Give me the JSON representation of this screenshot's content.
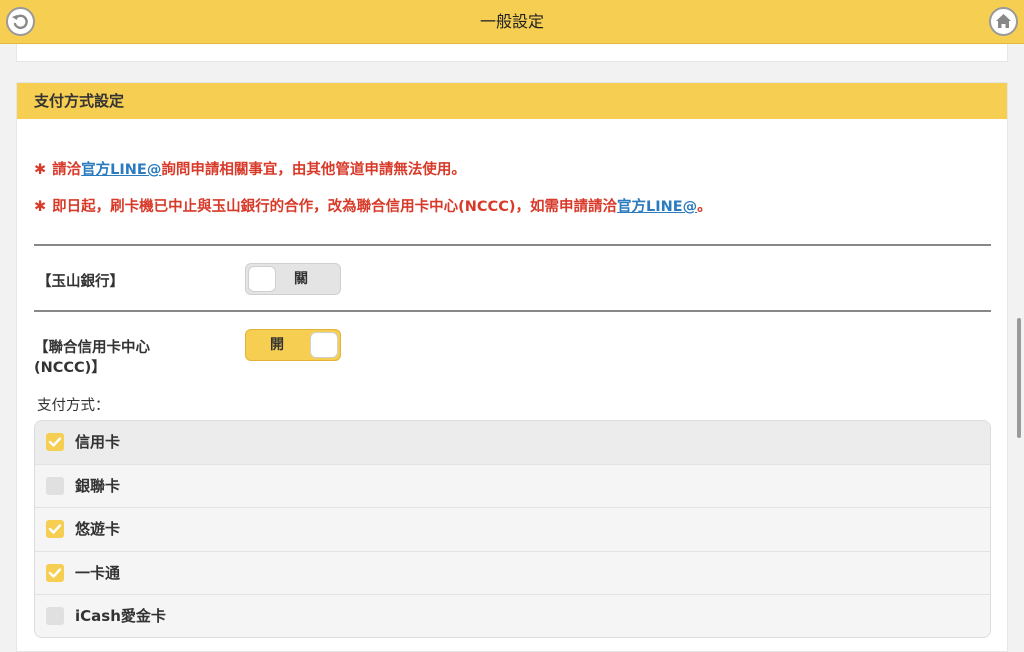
{
  "header": {
    "title": "一般設定"
  },
  "section": {
    "title": "支付方式設定",
    "notice1": {
      "star": "✱",
      "before": "請洽",
      "link": "官方LINE@",
      "after": "詢問申請相關事宜，由其他管道申請無法使用。"
    },
    "notice2": {
      "star": "✱",
      "before": "即日起，刷卡機已中止與玉山銀行的合作，改為聯合信用卡中心(NCCC)，如需申請請洽",
      "link": "官方LINE@",
      "after": "。"
    }
  },
  "banks": [
    {
      "label": "【玉山銀行】",
      "toggle_text": "關",
      "on": false
    },
    {
      "label_line1": "【聯合信用卡中心",
      "label_line2": "(NCCC)】",
      "toggle_text": "開",
      "on": true
    }
  ],
  "payment": {
    "label": "支付方式：",
    "items": [
      {
        "label": "信用卡",
        "checked": true
      },
      {
        "label": "銀聯卡",
        "checked": false
      },
      {
        "label": "悠遊卡",
        "checked": true
      },
      {
        "label": "一卡通",
        "checked": true
      },
      {
        "label": "iCash愛金卡",
        "checked": false
      }
    ]
  },
  "colors": {
    "accent": "#f6ce52",
    "notice": "#d83a2a",
    "link": "#2b7bbf"
  }
}
